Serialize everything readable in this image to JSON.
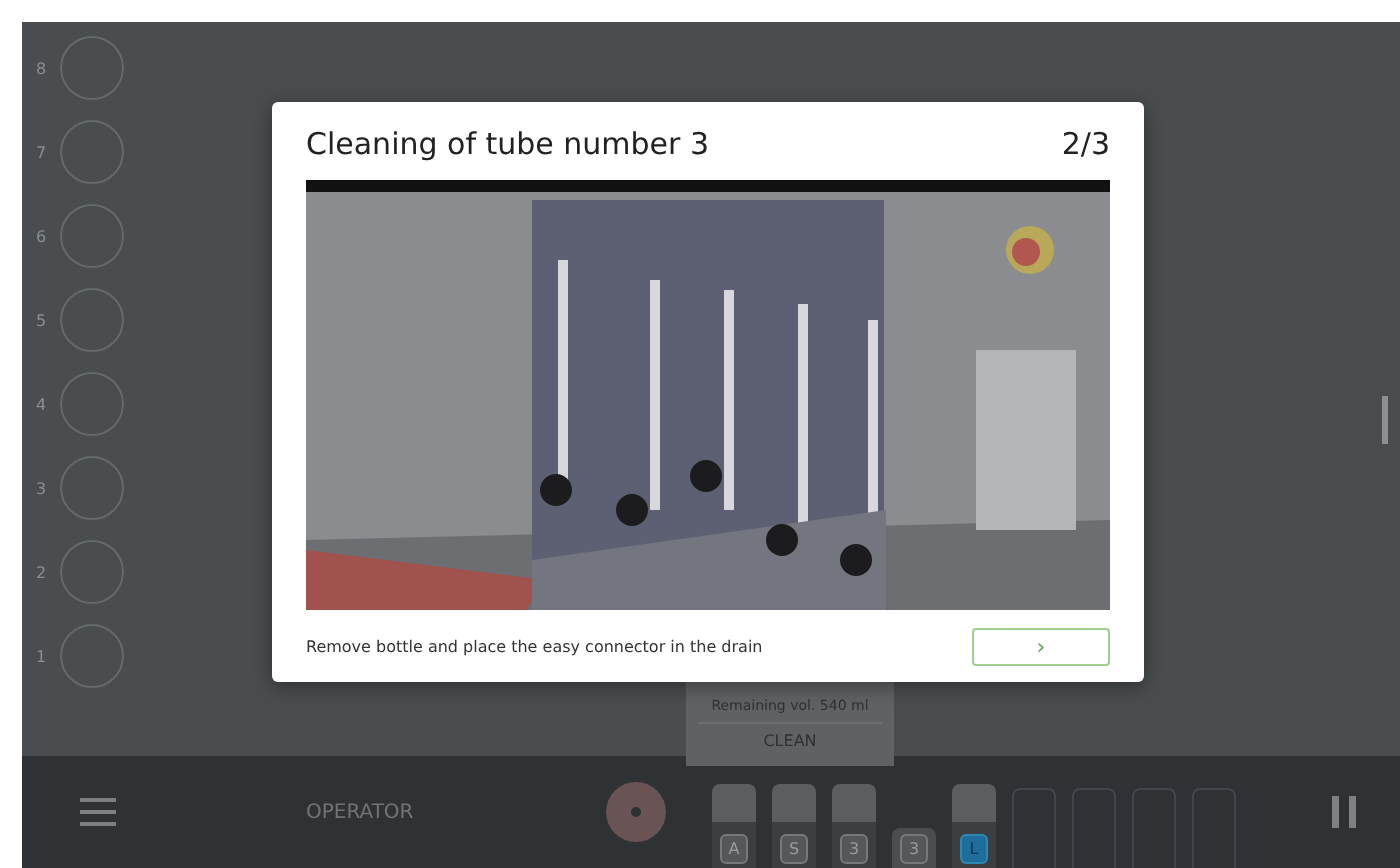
{
  "racks": [
    {
      "label": "8"
    },
    {
      "label": "7"
    },
    {
      "label": "6"
    },
    {
      "label": "5"
    },
    {
      "label": "4"
    },
    {
      "label": "3"
    },
    {
      "label": "2"
    },
    {
      "label": "1"
    }
  ],
  "popover": {
    "text": "Remaining vol. 540 ml",
    "button": "CLEAN"
  },
  "bottom_bar": {
    "user": "OPERATOR",
    "tubes": [
      {
        "kind": "tall",
        "label": "A",
        "active": false
      },
      {
        "kind": "tall",
        "label": "S",
        "active": false
      },
      {
        "kind": "tall",
        "label": "3",
        "active": false
      },
      {
        "kind": "short",
        "label": "3",
        "active": false
      },
      {
        "kind": "tall",
        "label": "L",
        "active": true
      },
      {
        "kind": "empty"
      },
      {
        "kind": "empty"
      },
      {
        "kind": "empty"
      },
      {
        "kind": "empty"
      }
    ]
  },
  "dialog": {
    "title": "Cleaning of tube number 3",
    "step": "2/3",
    "instruction": "Remove bottle and place the easy connector in the drain",
    "next_button": "›"
  }
}
